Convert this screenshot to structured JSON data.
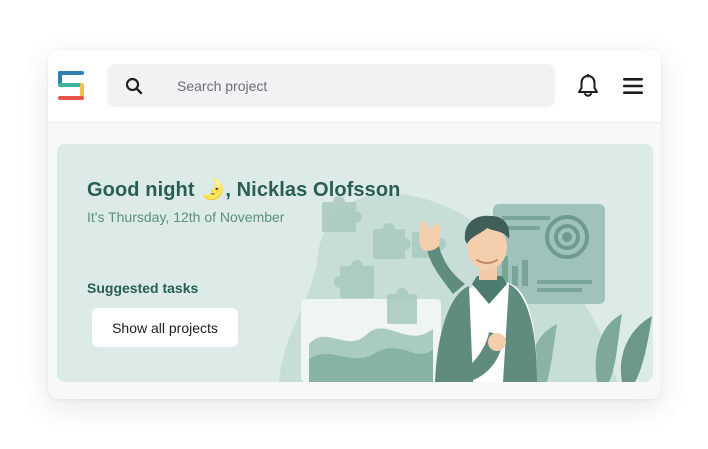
{
  "header": {
    "logo": "brand-logo",
    "search": {
      "placeholder": "Search project",
      "value": ""
    },
    "icons": [
      "search-icon",
      "bell-icon",
      "hamburger-menu-icon"
    ]
  },
  "banner": {
    "greeting_prefix": "Good night ",
    "greeting_emoji": "🌛",
    "greeting_name": ", Nicklas Olofsson",
    "date": "It's Thursday, 12th of November",
    "suggested_label": "Suggested tasks",
    "show_all_label": "Show all projects"
  },
  "colors": {
    "banner_bg": "#dcebe8",
    "accent_dark": "#2a5e50",
    "accent_muted": "#5d8f80",
    "illustration": "#8fb8ad"
  }
}
